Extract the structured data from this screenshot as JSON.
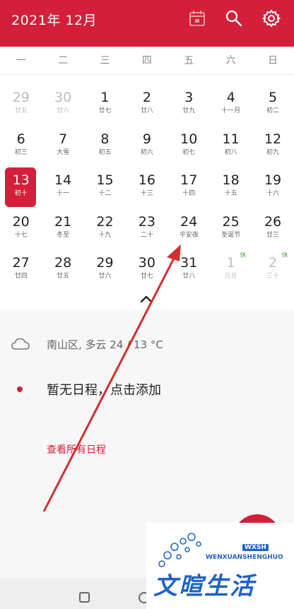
{
  "header": {
    "title": "2021年 12月",
    "calendar_icon": "calendar-icon",
    "search_icon": "search-icon",
    "settings_icon": "gear-icon"
  },
  "weekdays": [
    "一",
    "二",
    "三",
    "四",
    "五",
    "六",
    "日"
  ],
  "weeks": [
    [
      {
        "day": "29",
        "lunar": "廿五",
        "dim": true
      },
      {
        "day": "30",
        "lunar": "廿六",
        "dim": true
      },
      {
        "day": "1",
        "lunar": "廿七"
      },
      {
        "day": "2",
        "lunar": "廿八"
      },
      {
        "day": "3",
        "lunar": "廿九"
      },
      {
        "day": "4",
        "lunar": "十一月"
      },
      {
        "day": "5",
        "lunar": "初二"
      }
    ],
    [
      {
        "day": "6",
        "lunar": "初三"
      },
      {
        "day": "7",
        "lunar": "大雪"
      },
      {
        "day": "8",
        "lunar": "初五"
      },
      {
        "day": "9",
        "lunar": "初六"
      },
      {
        "day": "10",
        "lunar": "初七"
      },
      {
        "day": "11",
        "lunar": "初八"
      },
      {
        "day": "12",
        "lunar": "初九"
      }
    ],
    [
      {
        "day": "13",
        "lunar": "初十",
        "today": true
      },
      {
        "day": "14",
        "lunar": "十一"
      },
      {
        "day": "15",
        "lunar": "十二"
      },
      {
        "day": "16",
        "lunar": "十三"
      },
      {
        "day": "17",
        "lunar": "十四"
      },
      {
        "day": "18",
        "lunar": "十五"
      },
      {
        "day": "19",
        "lunar": "十六"
      }
    ],
    [
      {
        "day": "20",
        "lunar": "十七"
      },
      {
        "day": "21",
        "lunar": "冬至"
      },
      {
        "day": "22",
        "lunar": "十九"
      },
      {
        "day": "23",
        "lunar": "二十"
      },
      {
        "day": "24",
        "lunar": "平安夜"
      },
      {
        "day": "25",
        "lunar": "圣诞节"
      },
      {
        "day": "26",
        "lunar": "廿三"
      }
    ],
    [
      {
        "day": "27",
        "lunar": "廿四"
      },
      {
        "day": "28",
        "lunar": "廿五"
      },
      {
        "day": "29",
        "lunar": "廿六"
      },
      {
        "day": "30",
        "lunar": "廿七"
      },
      {
        "day": "31",
        "lunar": "廿八"
      },
      {
        "day": "1",
        "lunar": "元旦",
        "dim": true,
        "rest": "休"
      },
      {
        "day": "2",
        "lunar": "三十",
        "dim": true,
        "rest": "休"
      }
    ]
  ],
  "weather": {
    "icon": "cloud-icon",
    "text": "南山区, 多云  24 / 13 °C"
  },
  "schedule": {
    "empty_text": "暂无日程，点击添加",
    "view_all": "查看所有日程"
  },
  "watermark": {
    "abbr": "WXSH",
    "subtitle": "WENXUANSHENGHUO",
    "title": "文暄生活"
  },
  "colors": {
    "accent": "#d31f3a",
    "rest_badge": "#4caf50",
    "watermark": "#1e63c9"
  }
}
